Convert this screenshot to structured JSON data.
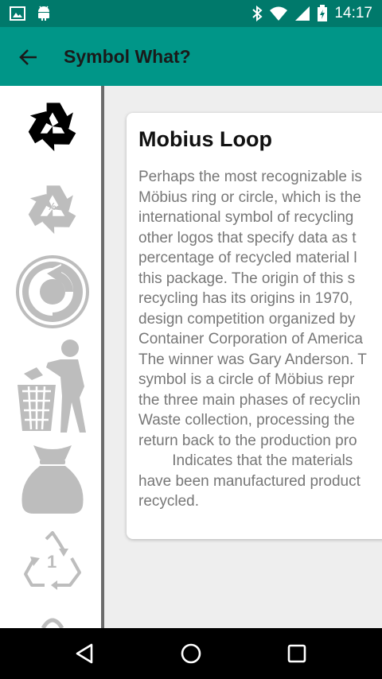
{
  "status_bar": {
    "time": "14:17",
    "left_icons": [
      "image-icon",
      "android-icon"
    ],
    "right_icons": [
      "bluetooth-icon",
      "wifi-icon",
      "signal-icon",
      "battery-icon"
    ]
  },
  "app_bar": {
    "title": "Symbol What?",
    "back_icon": "arrow-back-icon"
  },
  "sidebar": {
    "symbols": [
      {
        "name": "mobius-loop",
        "icon": "recycle-icon",
        "selected": true
      },
      {
        "name": "percent-recycled",
        "icon": "recycle-percent-icon",
        "selected": false,
        "label": "%"
      },
      {
        "name": "green-dot",
        "icon": "green-dot-icon",
        "selected": false
      },
      {
        "name": "tidy-man",
        "icon": "tidy-man-icon",
        "selected": false
      },
      {
        "name": "bag",
        "icon": "bag-icon",
        "selected": false
      },
      {
        "name": "pet-1",
        "icon": "plastic-code-icon",
        "selected": false,
        "label": "1"
      }
    ]
  },
  "detail": {
    "title": "Mobius Loop",
    "lines": [
      "Perhaps the most recognizable is",
      "Möbius ring or circle, which is the",
      "international symbol of recycling",
      "other logos that specify data as t",
      "percentage of recycled material l",
      "this package. The origin of this s",
      "recycling has its origins in 1970,",
      "design competition organized by",
      "Container Corporation of America",
      "The winner was Gary Anderson. T",
      "symbol is a circle of Möbius repr",
      "the three main phases of recyclin",
      "Waste collection, processing the",
      "return back to the production pro",
      "        Indicates that the materials",
      "have been manufactured product",
      "recycled."
    ]
  },
  "colors": {
    "status_bar": "#00796b",
    "app_bar": "#009688",
    "selected_symbol": "#000000",
    "unselected_symbol": "#bdbdbd"
  }
}
